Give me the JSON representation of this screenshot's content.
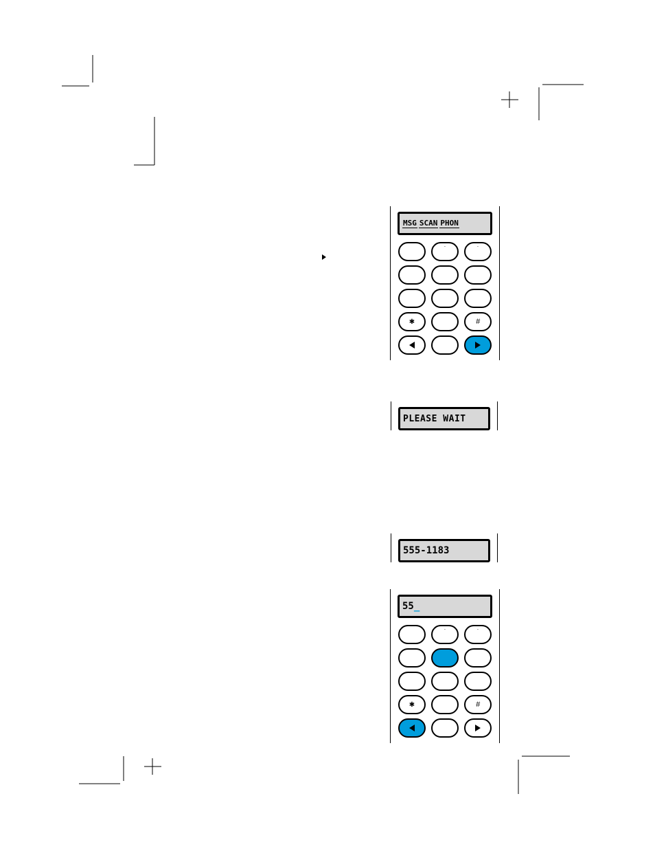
{
  "lcd_top_segments": [
    "MSG",
    "SCAN",
    "PHON"
  ],
  "lcd_wait": "PLEASE WAIT",
  "lcd_number": "555-1183",
  "lcd_partial": "55",
  "lcd_cursor": "_",
  "key_star": "✱",
  "key_hash": "#"
}
